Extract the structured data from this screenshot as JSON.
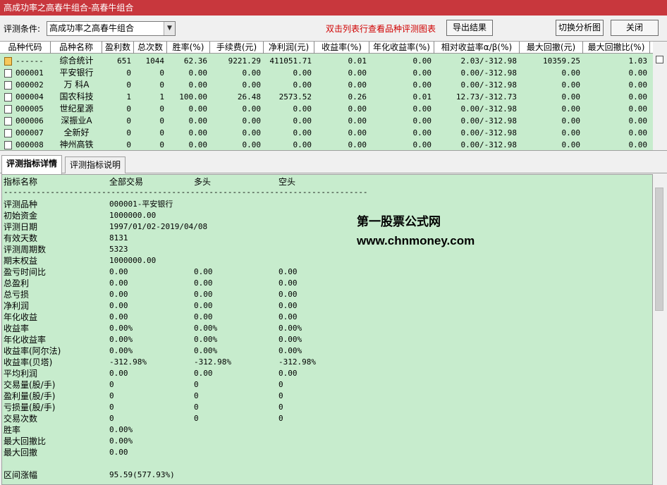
{
  "window": {
    "title": "高成功率之高春牛组合-高春牛组合"
  },
  "toolbar": {
    "condition_label": "评测条件:",
    "condition_value": "高成功率之高春牛组合",
    "hint": "双击列表行查看品种评测图表",
    "export_label": "导出结果",
    "switch_label": "切换分析图",
    "close_label": "关闭"
  },
  "table": {
    "headers": [
      "品种代码",
      "品种名称",
      "盈利数",
      "总次数",
      "胜率(%)",
      "手续费(元)",
      "净利润(元)",
      "收益率(%)",
      "年化收益率(%)",
      "相对收益率α/β(%)",
      "最大回撤(元)",
      "最大回撤比(%)"
    ],
    "rows": [
      [
        "------",
        "综合统计",
        "651",
        "1044",
        "62.36",
        "9221.29",
        "411051.71",
        "0.01",
        "0.00",
        "2.03/-312.98",
        "10359.25",
        "1.03"
      ],
      [
        "000001",
        "平安银行",
        "0",
        "0",
        "0.00",
        "0.00",
        "0.00",
        "0.00",
        "0.00",
        "0.00/-312.98",
        "0.00",
        "0.00"
      ],
      [
        "000002",
        "万 科A",
        "0",
        "0",
        "0.00",
        "0.00",
        "0.00",
        "0.00",
        "0.00",
        "0.00/-312.98",
        "0.00",
        "0.00"
      ],
      [
        "000004",
        "国农科技",
        "1",
        "1",
        "100.00",
        "26.48",
        "2573.52",
        "0.26",
        "0.01",
        "12.73/-312.73",
        "0.00",
        "0.00"
      ],
      [
        "000005",
        "世纪星源",
        "0",
        "0",
        "0.00",
        "0.00",
        "0.00",
        "0.00",
        "0.00",
        "0.00/-312.98",
        "0.00",
        "0.00"
      ],
      [
        "000006",
        "深振业A",
        "0",
        "0",
        "0.00",
        "0.00",
        "0.00",
        "0.00",
        "0.00",
        "0.00/-312.98",
        "0.00",
        "0.00"
      ],
      [
        "000007",
        "全新好",
        "0",
        "0",
        "0.00",
        "0.00",
        "0.00",
        "0.00",
        "0.00",
        "0.00/-312.98",
        "0.00",
        "0.00"
      ],
      [
        "000008",
        "神州高铁",
        "0",
        "0",
        "0.00",
        "0.00",
        "0.00",
        "0.00",
        "0.00",
        "0.00/-312.98",
        "0.00",
        "0.00"
      ]
    ]
  },
  "tabs": [
    {
      "label": "评测指标详情",
      "active": true
    },
    {
      "label": "评测指标说明",
      "active": false
    }
  ],
  "detail": {
    "header": [
      "指标名称",
      "全部交易",
      "多头",
      "空头"
    ],
    "separator": "------------------------------------------------------------------------------",
    "lines": [
      [
        "评测品种",
        "000001-平安银行",
        "",
        ""
      ],
      [
        "初始资金",
        "1000000.00",
        "",
        ""
      ],
      [
        "评测日期",
        "1997/01/02-2019/04/08",
        "",
        ""
      ],
      [
        "有效天数",
        "8131",
        "",
        ""
      ],
      [
        "评测周期数",
        "5323",
        "",
        ""
      ],
      [
        "期末权益",
        "1000000.00",
        "",
        ""
      ],
      [
        "盈亏时间比",
        "0.00",
        "0.00",
        "0.00"
      ],
      [
        "总盈利",
        "0.00",
        "0.00",
        "0.00"
      ],
      [
        "总亏损",
        "0.00",
        "0.00",
        "0.00"
      ],
      [
        "净利润",
        "0.00",
        "0.00",
        "0.00"
      ],
      [
        "年化收益",
        "0.00",
        "0.00",
        "0.00"
      ],
      [
        "收益率",
        "0.00%",
        "0.00%",
        "0.00%"
      ],
      [
        "年化收益率",
        "0.00%",
        "0.00%",
        "0.00%"
      ],
      [
        "收益率(阿尔法)",
        "0.00%",
        "0.00%",
        "0.00%"
      ],
      [
        "收益率(贝塔)",
        "-312.98%",
        "-312.98%",
        "-312.98%"
      ],
      [
        "平均利润",
        "0.00",
        "0.00",
        "0.00"
      ],
      [
        "交易量(股/手)",
        "0",
        "0",
        "0"
      ],
      [
        "盈利量(股/手)",
        "0",
        "0",
        "0"
      ],
      [
        "亏损量(股/手)",
        "0",
        "0",
        "0"
      ],
      [
        "交易次数",
        "0",
        "0",
        "0"
      ],
      [
        "胜率",
        "0.00%",
        "",
        ""
      ],
      [
        "最大回撤比",
        "0.00%",
        "",
        ""
      ],
      [
        "最大回撤",
        "0.00",
        "",
        ""
      ],
      [
        "",
        "",
        "",
        ""
      ],
      [
        "区间涨幅",
        "95.59(577.93%)",
        "",
        ""
      ]
    ],
    "watermark_cn": "第一股票公式网",
    "watermark_url": "www.chnmoney.com"
  }
}
